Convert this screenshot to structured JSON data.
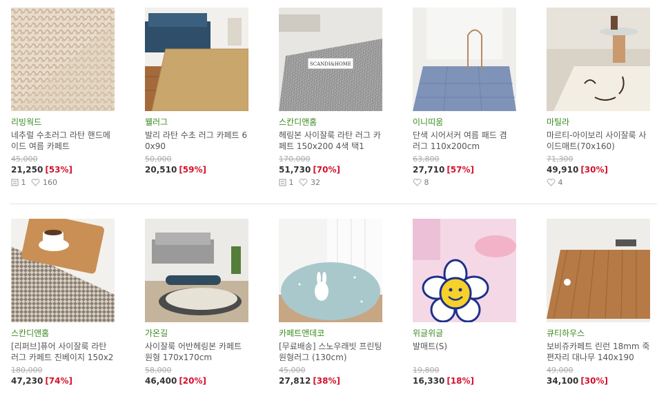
{
  "row1": [
    {
      "brand": "리빙웍드",
      "title": "네추럴 수초러그 라탄 핸드메이드 여름 카페트",
      "original_price": "45,000",
      "price": "21,250",
      "discount": "[53%]",
      "reviews": "1",
      "likes": "160"
    },
    {
      "brand": "웰러그",
      "title": "발리 라탄 수초 러그 카페트 60x90",
      "original_price": "50,000",
      "price": "20,510",
      "discount": "[59%]",
      "reviews": "",
      "likes": ""
    },
    {
      "brand": "스칸디앤홈",
      "title": "헤링본 사이잘룩 라탄 러그 카페트 150x200 4색 택1",
      "original_price": "170,000",
      "price": "51,730",
      "discount": "[70%]",
      "reviews": "1",
      "likes": "32",
      "thumb_text": "SCANDI&HOME"
    },
    {
      "brand": "이니띠움",
      "title": "단색 시어서커 여름 패드 겸 러그 110x200cm",
      "original_price": "63,800",
      "price": "27,710",
      "discount": "[57%]",
      "reviews": "",
      "likes": "8"
    },
    {
      "brand": "마틸라",
      "title": "마르티-아이보리 사이잘룩 사이드매트(70x160)",
      "original_price": "71,300",
      "price": "49,910",
      "discount": "[30%]",
      "reviews": "",
      "likes": "4"
    }
  ],
  "row2": [
    {
      "brand": "스칸디앤홈",
      "title": "[리퍼브]퓨어 사이잘룩 라탄 러그 카페트 진베이지 150x20",
      "original_price": "180,000",
      "price": "47,230",
      "discount": "[74%]"
    },
    {
      "brand": "가온길",
      "title": "사이잘룩 어반헤링본 카페트 원형 170x170cm",
      "original_price": "58,000",
      "price": "46,400",
      "discount": "[20%]"
    },
    {
      "brand": "카페트앤데코",
      "title": "[무료배송] 스노우래빗 프린팅 원형러그 (130cm)",
      "original_price": "45,000",
      "price": "27,812",
      "discount": "[38%]"
    },
    {
      "brand": "위글위글",
      "title": "발매트(S)",
      "original_price": "19,800",
      "price": "16,330",
      "discount": "[18%]"
    },
    {
      "brand": "큐티하우스",
      "title": "보비쥬카페트 린런 18mm 죽편자리 대나무 140x190",
      "original_price": "49,000",
      "price": "34,100",
      "discount": "[30%]"
    }
  ],
  "icons": {
    "review": "review-icon",
    "like": "heart-icon"
  },
  "colors": {
    "brand": "#3a8a1f",
    "discount": "#d3112b",
    "original_price": "#aaaaaa"
  }
}
